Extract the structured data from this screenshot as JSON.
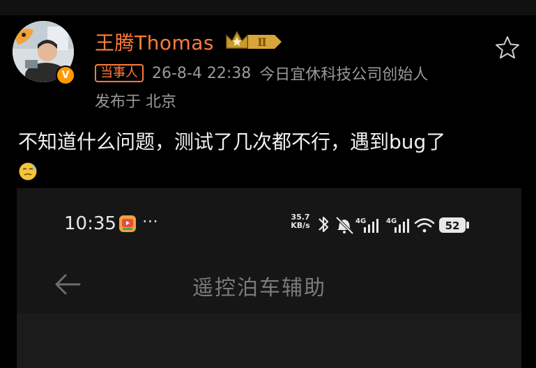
{
  "post": {
    "username": "王腾Thomas",
    "level": "Ⅱ",
    "role_tag": "当事人",
    "timestamp": "26-8-4 22:38",
    "description": "今日宜休科技公司创始人",
    "location": "发布于 北京",
    "text": "不知道什么问题，测试了几次都不行，遇到bug了",
    "emoji": "sweat-face-icon",
    "verified_badge": "V",
    "accent_color": "#ff7d3a"
  },
  "screenshot": {
    "status_bar": {
      "time": "10:35",
      "more": "···",
      "net_speed_value": "35.7",
      "net_speed_unit": "KB/s",
      "network_1": "4G",
      "network_2": "4G",
      "battery": "52"
    },
    "screen_title": "遥控泊车辅助"
  }
}
